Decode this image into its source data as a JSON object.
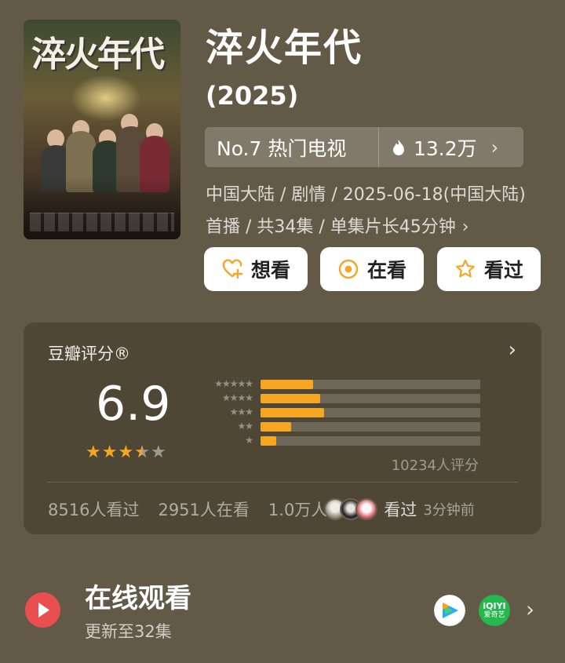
{
  "poster": {
    "title_text": "淬火年代"
  },
  "show": {
    "title": "淬火年代",
    "year": "(2025)",
    "rank_label": "No.7 热门电视",
    "heat": "13.2万",
    "meta": "中国大陆 / 剧情 / 2025-06-18(中国大陆)首播 / 共34集 / 单集片长45分钟",
    "meta_chevron": "›"
  },
  "actions": [
    {
      "label": "想看",
      "icon": "heart-plus-icon"
    },
    {
      "label": "在看",
      "icon": "target-icon"
    },
    {
      "label": "看过",
      "icon": "star-outline-icon"
    }
  ],
  "rating": {
    "title": "豆瓣评分®",
    "score": "6.9",
    "stars_value": 3.5,
    "distribution": [
      {
        "stars": "★★★★★",
        "fraction": 0.24
      },
      {
        "stars": "★★★★",
        "fraction": 0.27
      },
      {
        "stars": "★★★",
        "fraction": 0.29
      },
      {
        "stars": "★★",
        "fraction": 0.14
      },
      {
        "stars": "★",
        "fraction": 0.07
      }
    ],
    "count_label": "10234人评分",
    "watched": "8516人看过",
    "watching": "2951人在看",
    "want": "1.0万人",
    "friend_action": "看过",
    "time_ago": "3分钟前"
  },
  "online": {
    "title": "在线观看",
    "subtitle": "更新至32集",
    "platforms": [
      "tencent-video-icon",
      "iqiyi-icon"
    ],
    "iqiyi_label": "iQIYI"
  },
  "colors": {
    "background": "#625947",
    "accent": "#f5a623",
    "play_red": "#e94f4f",
    "iqiyi_green": "#25b84f"
  }
}
